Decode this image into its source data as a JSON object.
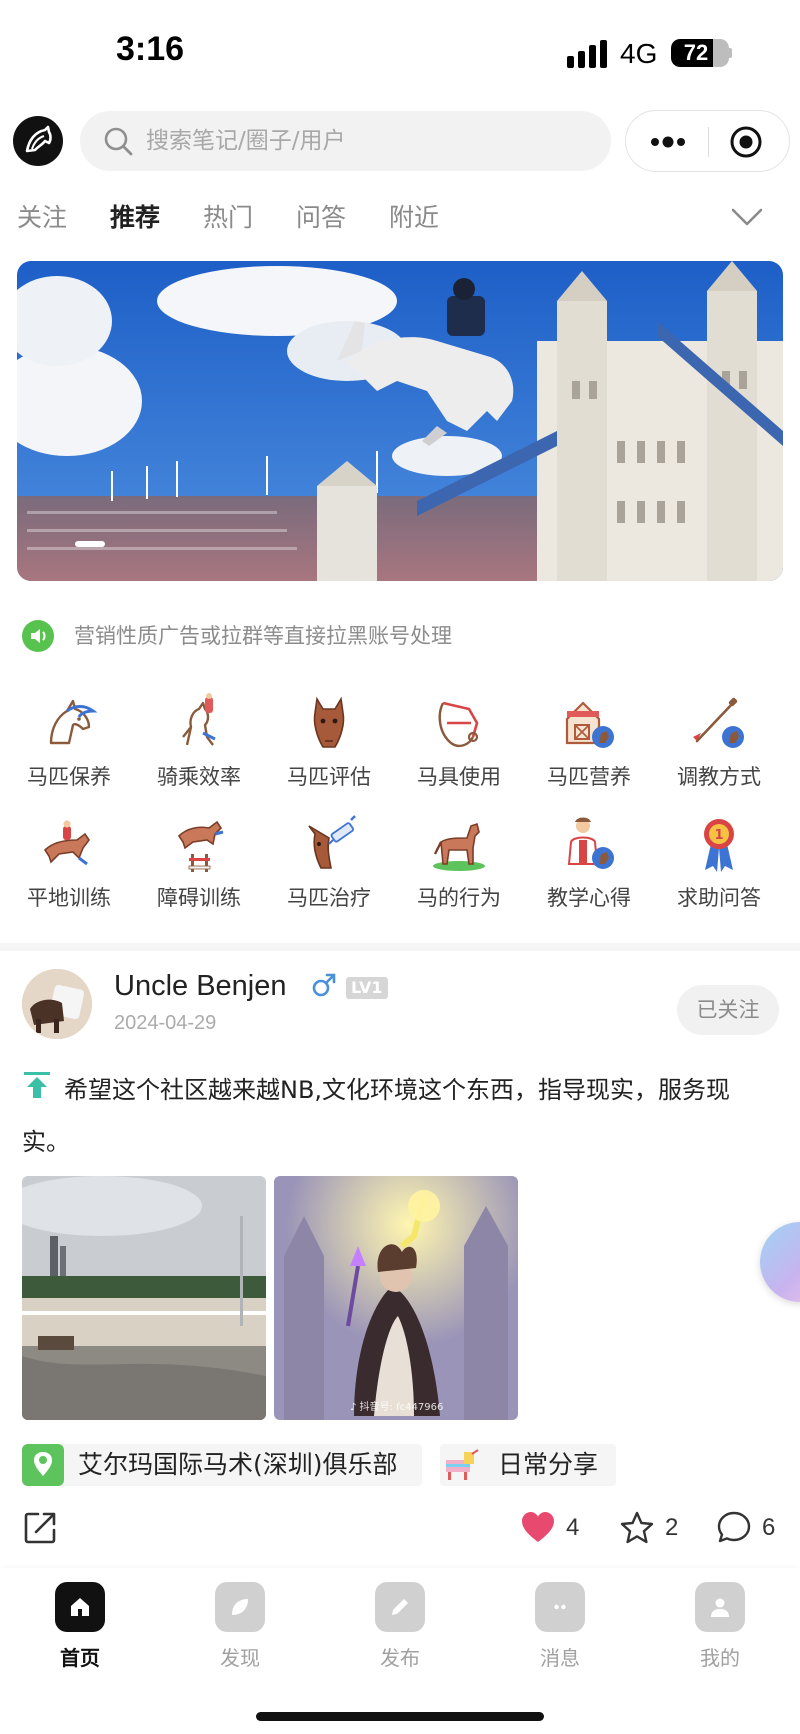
{
  "status_bar": {
    "time": "3:16",
    "network": "4G",
    "battery_level": "72",
    "battery_fraction": 0.72
  },
  "header": {
    "logo_icon": "horse-head-logo-icon",
    "search_placeholder": "搜索笔记/圈子/用户",
    "more_icon": "more-dots-icon",
    "close_icon": "target-circle-icon"
  },
  "tabs": [
    {
      "label": "关注",
      "active": false
    },
    {
      "label": "推荐",
      "active": true
    },
    {
      "label": "热门",
      "active": false
    },
    {
      "label": "问答",
      "active": false
    },
    {
      "label": "附近",
      "active": false
    }
  ],
  "banner": {
    "image": "show-jumping-horse-over-castle-fence-photo",
    "active_slide": 1
  },
  "notice": {
    "icon": "speaker-icon",
    "text": "营销性质广告或拉群等直接拉黑账号处理"
  },
  "categories": [
    {
      "label": "马匹保养",
      "icon": "horse-care-icon"
    },
    {
      "label": "骑乘效率",
      "icon": "riding-horse-icon"
    },
    {
      "label": "马匹评估",
      "icon": "horse-head-icon"
    },
    {
      "label": "马具使用",
      "icon": "bridle-icon"
    },
    {
      "label": "马匹营养",
      "icon": "feed-barn-icon"
    },
    {
      "label": "调教方式",
      "icon": "riding-crop-icon"
    },
    {
      "label": "平地训练",
      "icon": "galloping-horse-icon"
    },
    {
      "label": "障碍训练",
      "icon": "jumping-horse-icon"
    },
    {
      "label": "马匹治疗",
      "icon": "horse-syringe-icon"
    },
    {
      "label": "马的行为",
      "icon": "standing-horse-icon"
    },
    {
      "label": "教学心得",
      "icon": "instructor-icon"
    },
    {
      "label": "求助问答",
      "icon": "rosette-award-icon"
    }
  ],
  "post": {
    "author": "Uncle Benjen",
    "gender_icon": "male-symbol-icon",
    "level": "LV1",
    "date": "2024-04-29",
    "follow_label": "已关注",
    "pinned_icon": "pin-top-icon",
    "text": "希望这个社区越来越NB,文化环境这个东西，指导现实，服务现实。",
    "images": [
      {
        "description": "arena-track-photo"
      },
      {
        "description": "sorceress-fantasy-art",
        "watermark": "♪ 抖音号: fc447966"
      }
    ],
    "tags": [
      {
        "label": "艾尔玛国际马术(深圳)俱乐部",
        "icon": "location-pin-icon"
      },
      {
        "label": "日常分享",
        "icon": "pinata-icon"
      }
    ],
    "actions": {
      "share_icon": "share-icon",
      "likes": "4",
      "favorites": "2",
      "comments": "6"
    }
  },
  "bottom_nav": [
    {
      "label": "首页",
      "icon": "home-icon",
      "active": true
    },
    {
      "label": "发现",
      "icon": "compass-leaf-icon",
      "active": false
    },
    {
      "label": "发布",
      "icon": "pencil-icon",
      "active": false
    },
    {
      "label": "消息",
      "icon": "chat-icon",
      "active": false
    },
    {
      "label": "我的",
      "icon": "user-icon",
      "active": false
    }
  ],
  "colors": {
    "accent_text": "#222222",
    "muted_text": "#8a8a8a",
    "like_red": "#e84a6f",
    "notice_green": "#58c24e",
    "tag_location_green": "#5cc35d"
  }
}
